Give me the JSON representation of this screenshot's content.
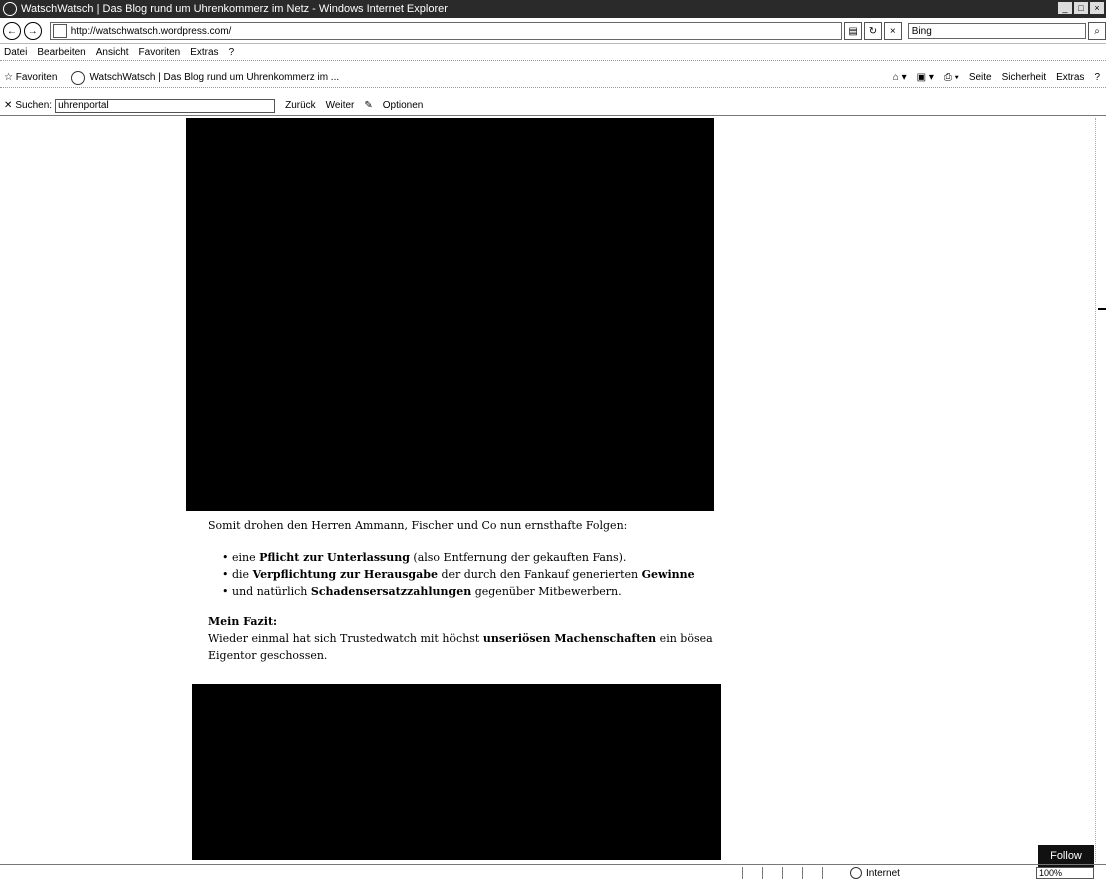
{
  "window": {
    "title": "WatschWatsch | Das Blog rund um Uhrenkommerz im Netz - Windows Internet Explorer"
  },
  "address": {
    "url": "http://watschwatsch.wordpress.com/",
    "search_value": "Bing"
  },
  "menu": [
    "Datei",
    "Bearbeiten",
    "Ansicht",
    "Favoriten",
    "Extras",
    "?"
  ],
  "favorites_bar": {
    "favorites_label": "Favoriten",
    "tab_label": "WatschWatsch | Das Blog rund um Uhrenkommerz im ...",
    "tools": [
      "Seite",
      "Sicherheit",
      "Extras"
    ]
  },
  "find_bar": {
    "label": "Suchen:",
    "value": "uhrenportal",
    "back_label": "Zurück",
    "next_label": "Weiter",
    "options_label": "Optionen"
  },
  "article": {
    "intro": "Somit drohen den Herren Ammann, Fischer und Co nun ernsthafte Folgen:",
    "bullets": [
      {
        "pre": "eine ",
        "bold": "Pflicht zur Unterlassung",
        "post": " (also Entfernung der gekauften Fans)."
      },
      {
        "pre": "die ",
        "bold": "Verpflichtung zur Herausgabe",
        "post": " der durch den Fankauf generierten ",
        "bold2": "Gewinne"
      },
      {
        "pre": "und natürlich ",
        "bold": "Schadensersatzzahlungen",
        "post": " gegenüber Mitbewerbern."
      }
    ],
    "conclusion_heading": "Mein Fazit:",
    "conclusion_pre": "Wieder einmal hat sich Trustedwatch mit höchst ",
    "conclusion_bold": "unseriösen Machenschaften",
    "conclusion_post": " ein bösea Eigentor geschossen."
  },
  "follow_button": "Follow",
  "status": {
    "zone": "Internet",
    "zoom": "100%"
  }
}
